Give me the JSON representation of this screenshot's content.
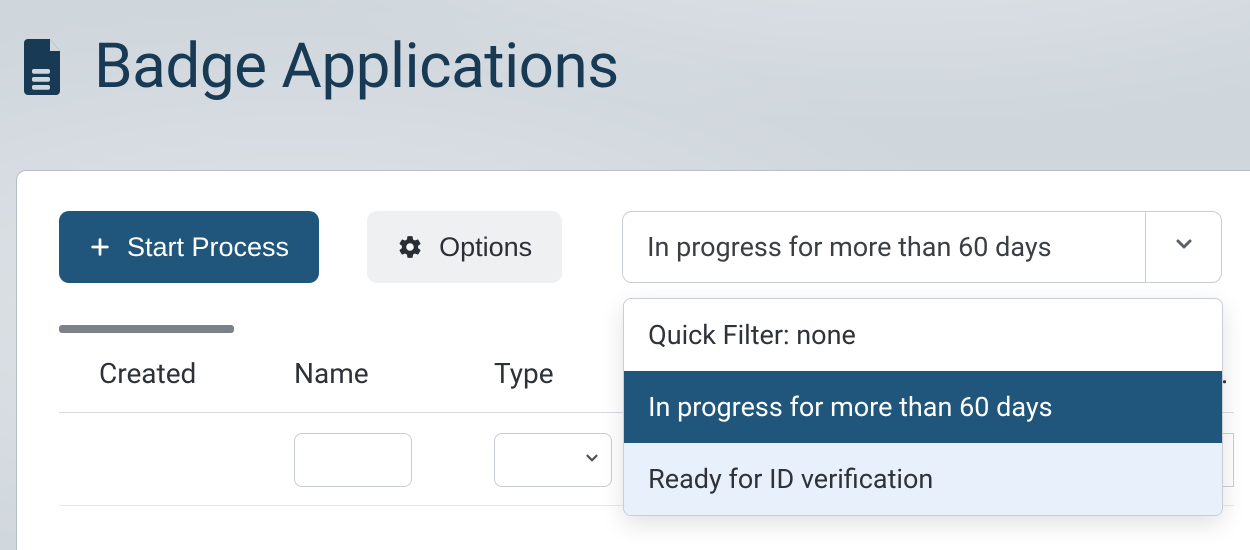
{
  "page": {
    "title": "Badge Applications"
  },
  "toolbar": {
    "start_process_label": "Start Process",
    "options_label": "Options"
  },
  "filter": {
    "selected_label": "In progress for more than 60 days",
    "options": [
      {
        "label": "Quick Filter: none",
        "state": "normal"
      },
      {
        "label": "In progress for more than 60 days",
        "state": "selected"
      },
      {
        "label": "Ready for ID verification",
        "state": "hovered"
      }
    ]
  },
  "table": {
    "columns": {
      "created": "Created",
      "name": "Name",
      "type": "Type"
    },
    "overflow_indicator": "…"
  },
  "colors": {
    "primary": "#20567c",
    "text_dark": "#183a55",
    "panel_bg": "#ffffff",
    "page_bg": "#cfd6dc"
  }
}
